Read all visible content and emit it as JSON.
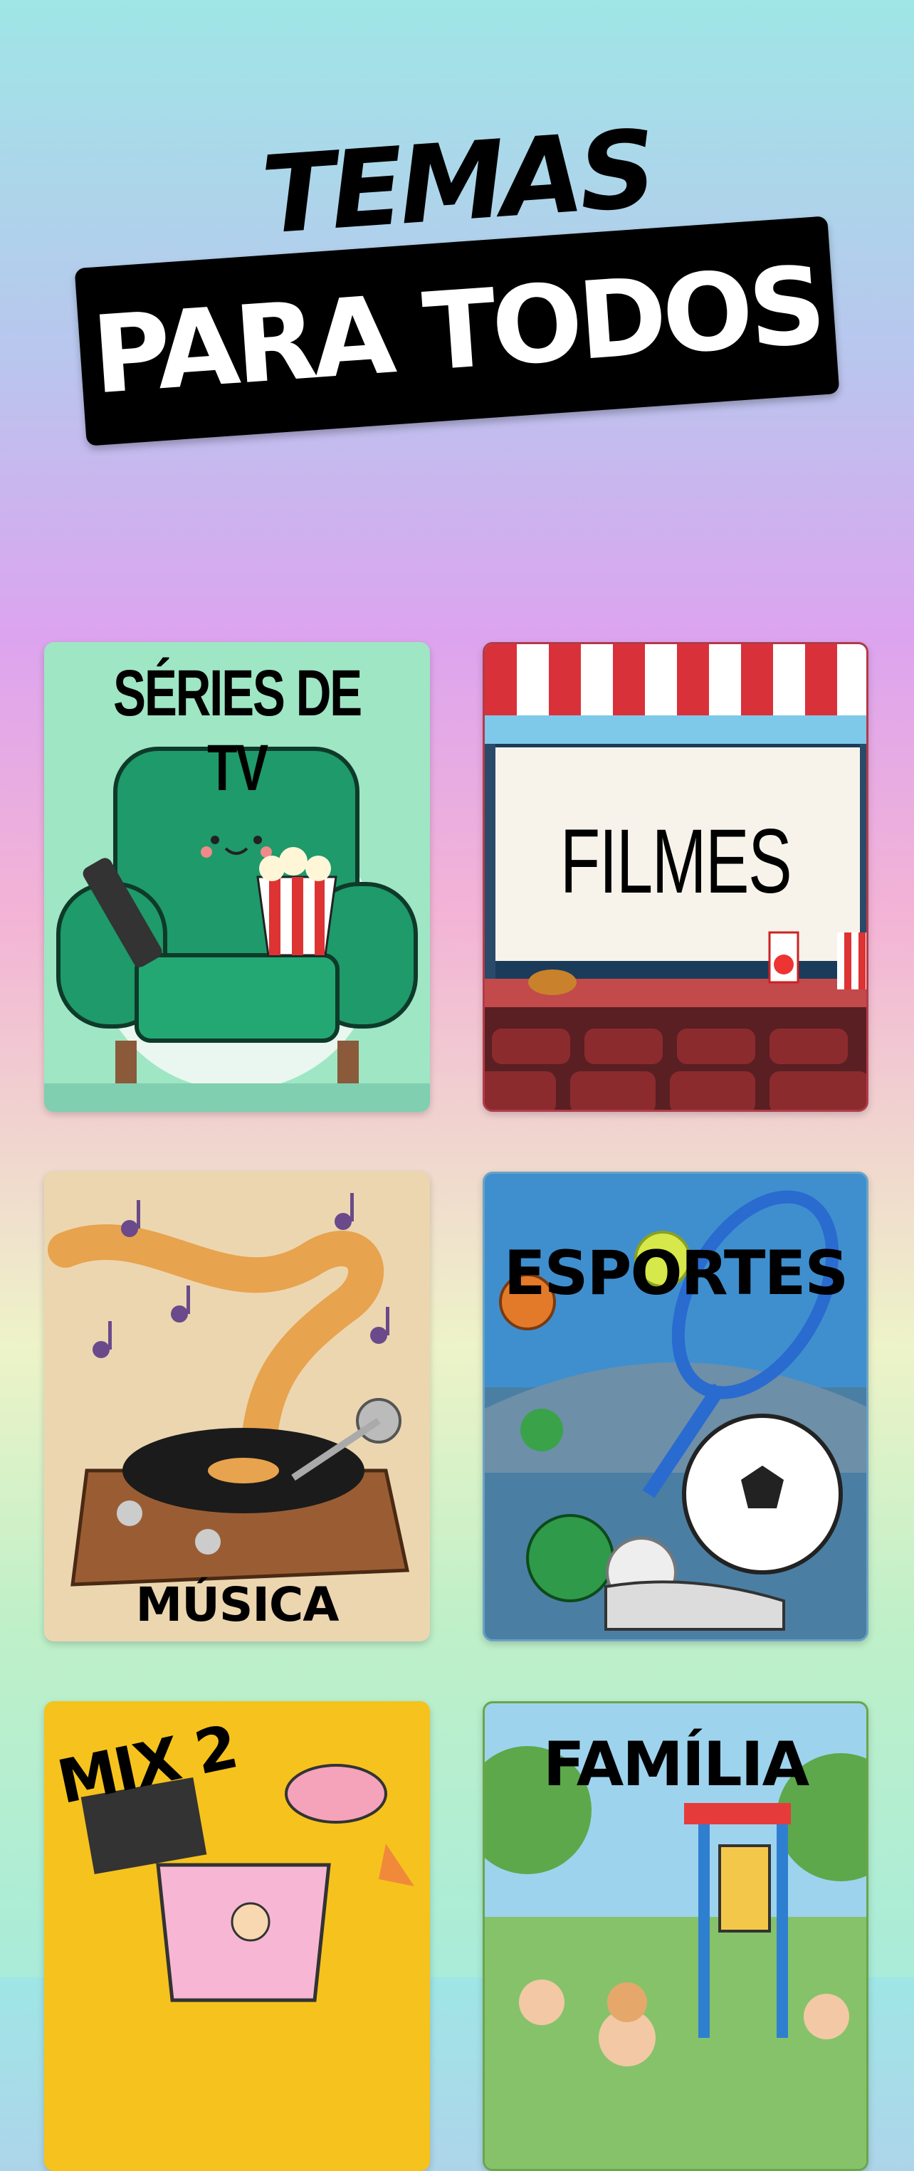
{
  "hero": {
    "title": "TEMAS",
    "banner": "PARA TODOS"
  },
  "cards": [
    {
      "label": "SÉRIES DE TV",
      "icon": "armchair-popcorn-icon"
    },
    {
      "label": "FILMES",
      "icon": "cinema-screen-icon"
    },
    {
      "label": "MÚSICA",
      "icon": "record-player-icon"
    },
    {
      "label": "ESPORTES",
      "icon": "sports-balls-icon"
    },
    {
      "label": "MIX 2",
      "icon": "blender-mix-icon"
    },
    {
      "label": "FAMÍLIA",
      "icon": "playground-icon"
    }
  ],
  "colors": {
    "banner_bg": "#000000",
    "banner_text": "#ffffff",
    "series_bg": "#9fe6c4",
    "mix_bg": "#f6c21d"
  }
}
